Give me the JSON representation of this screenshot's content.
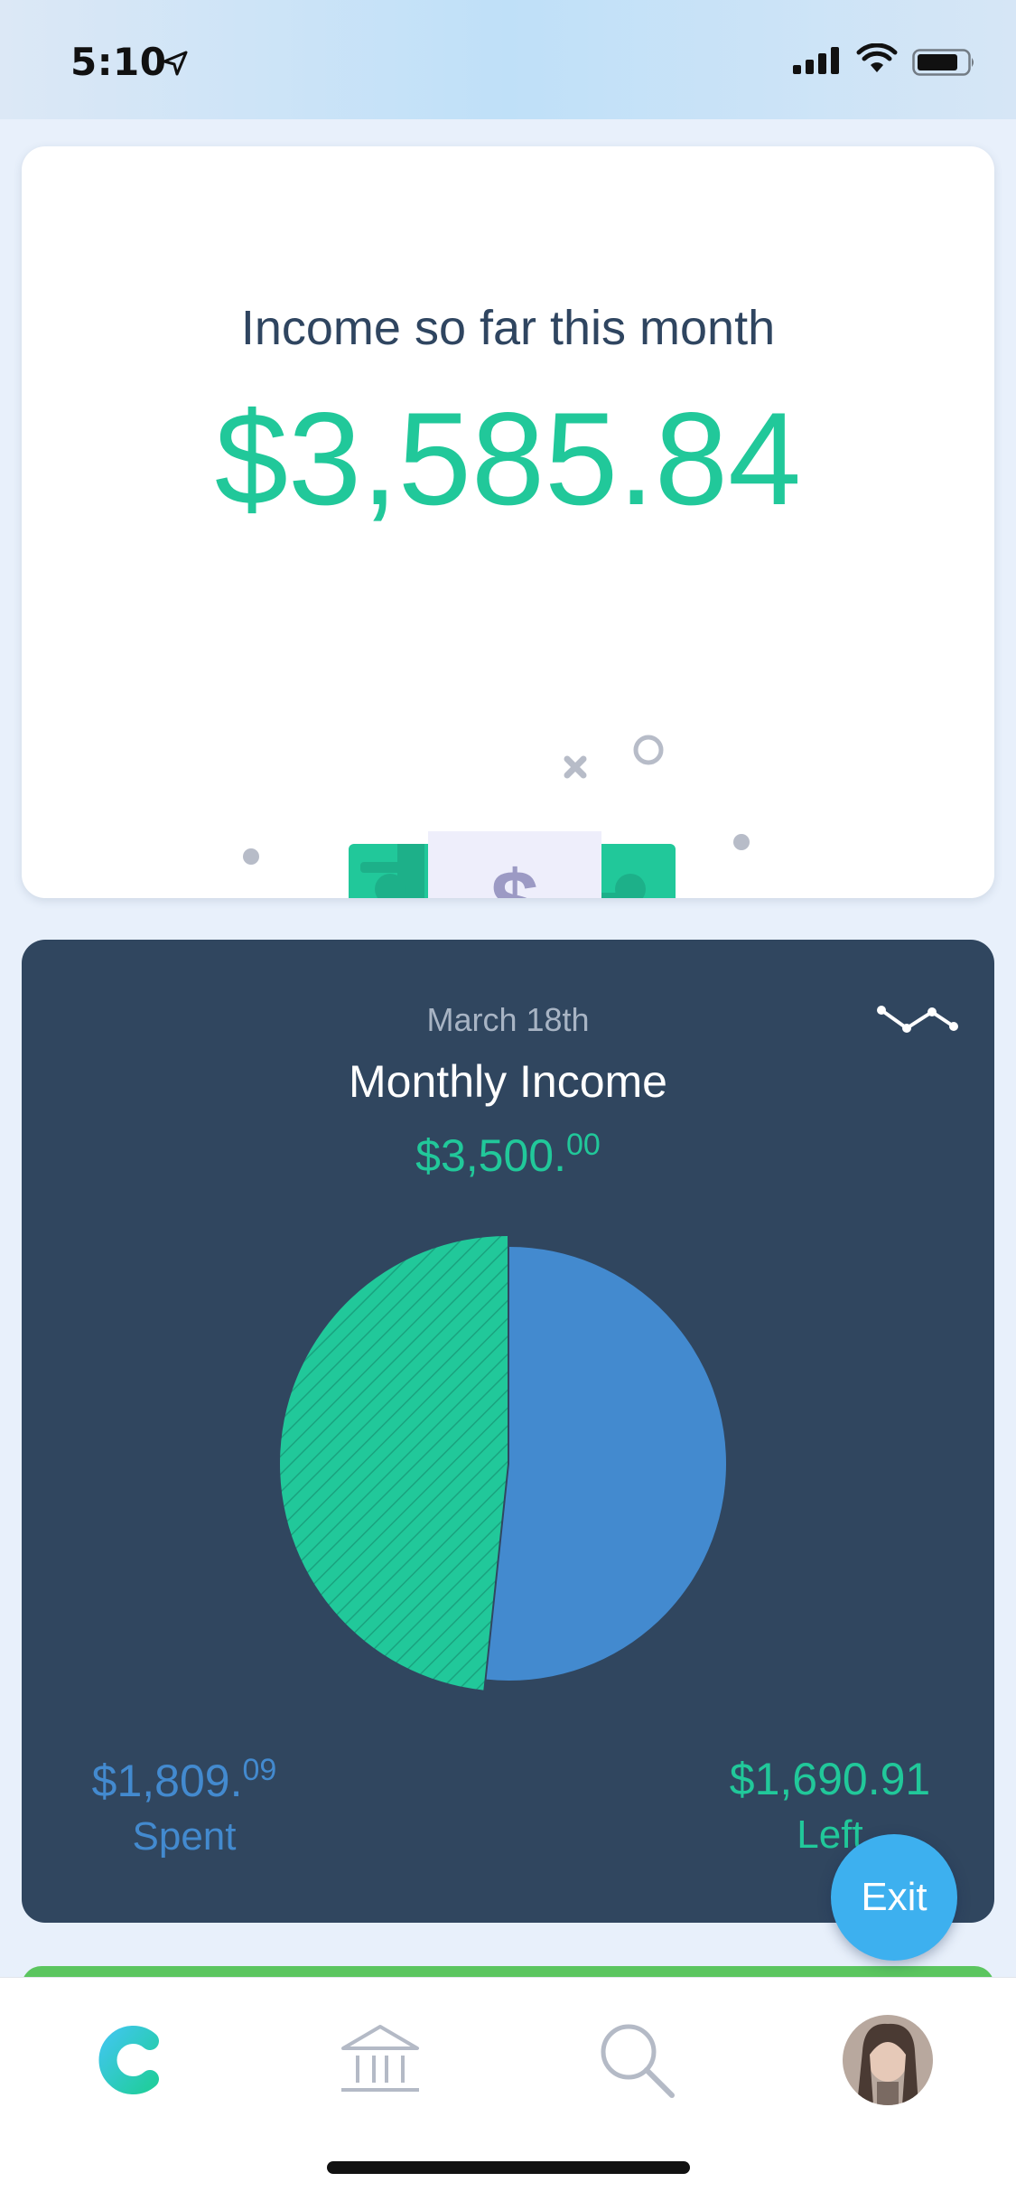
{
  "status_bar": {
    "time": "5:10",
    "icons": [
      "location-arrow-icon",
      "cellular-signal-icon",
      "wifi-icon",
      "battery-icon"
    ]
  },
  "income_card": {
    "title": "Income so far this month",
    "amount": "$3,585.84",
    "illustration": "cash-stack-illustration"
  },
  "monthly_card": {
    "date": "March 18th",
    "title": "Monthly Income",
    "amount_main": "$3,500.",
    "amount_cents": "00",
    "trend_icon": "line-trend-icon",
    "spent": {
      "main": "$1,809.",
      "cents": "09",
      "label": "Spent"
    },
    "left": {
      "value": "$1,690.91",
      "label": "Left"
    }
  },
  "chart_data": {
    "type": "pie",
    "slices": [
      {
        "label": "Spent",
        "value": 1809.09,
        "color": "#438ACF"
      },
      {
        "label": "Left",
        "value": 1690.91,
        "color": "#21C89A"
      }
    ]
  },
  "exit_button": {
    "label": "Exit"
  },
  "tab_bar": {
    "items": [
      {
        "name": "home",
        "icon": "app-logo-icon",
        "active": true
      },
      {
        "name": "accounts",
        "icon": "bank-icon",
        "active": false
      },
      {
        "name": "search",
        "icon": "search-icon",
        "active": false
      },
      {
        "name": "profile",
        "icon": "avatar",
        "active": false
      }
    ]
  },
  "colors": {
    "accent_green": "#21C89A",
    "accent_blue": "#438ACF",
    "card_dark": "#30465F",
    "text_dark": "#2F4560",
    "exit_blue": "#3DB0EF"
  }
}
